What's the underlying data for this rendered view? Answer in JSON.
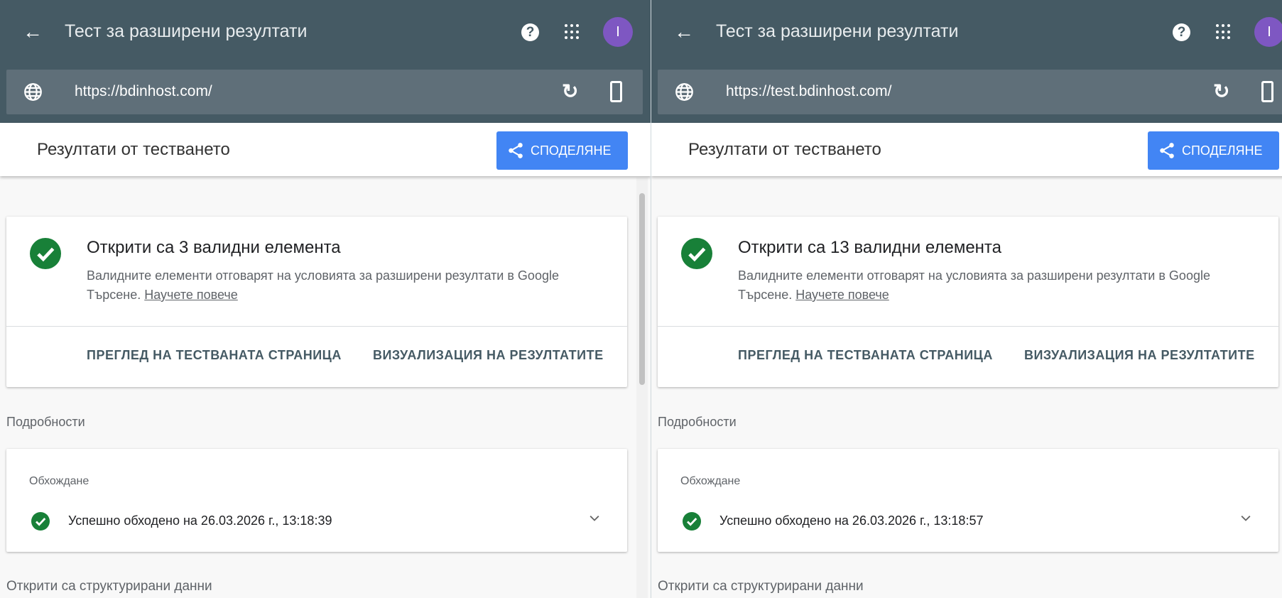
{
  "colors": {
    "header": "#455a64",
    "accent": "#4285f4",
    "success": "#188038",
    "avatar": "#7e57c2"
  },
  "panes": [
    {
      "app_title": "Тест за разширени резултати",
      "avatar_letter": "I",
      "url": "https://bdinhost.com/",
      "results_title": "Резултати от тестването",
      "share_label": "СПОДЕЛЯНЕ",
      "summary_heading": "Открити са 3 валидни елемента",
      "summary_desc": "Валидните елементи отговарят на условията за разширени резултати в Google Търсене.",
      "learn_more": "Научете повече",
      "view_page_btn": "ПРЕГЛЕД НА ТЕСТВАНАТА СТРАНИЦА",
      "preview_btn": "ВИЗУАЛИЗАЦИЯ НА РЕЗУЛТАТИТЕ",
      "details_label": "Подробности",
      "crawl_label": "Обхождане",
      "crawl_status": "Успешно обходено на 26.03.2026 г., 13:18:39",
      "structured_label": "Открити са структурирани данни"
    },
    {
      "app_title": "Тест за разширени резултати",
      "avatar_letter": "I",
      "url": "https://test.bdinhost.com/",
      "results_title": "Резултати от тестването",
      "share_label": "СПОДЕЛЯНЕ",
      "summary_heading": "Открити са 13 валидни елемента",
      "summary_desc": "Валидните елементи отговарят на условията за разширени резултати в Google Търсене.",
      "learn_more": "Научете повече",
      "view_page_btn": "ПРЕГЛЕД НА ТЕСТВАНАТА СТРАНИЦА",
      "preview_btn": "ВИЗУАЛИЗАЦИЯ НА РЕЗУЛТАТИТЕ",
      "details_label": "Подробности",
      "crawl_label": "Обхождане",
      "crawl_status": "Успешно обходено на 26.03.2026 г., 13:18:57",
      "structured_label": "Открити са структурирани данни"
    }
  ]
}
